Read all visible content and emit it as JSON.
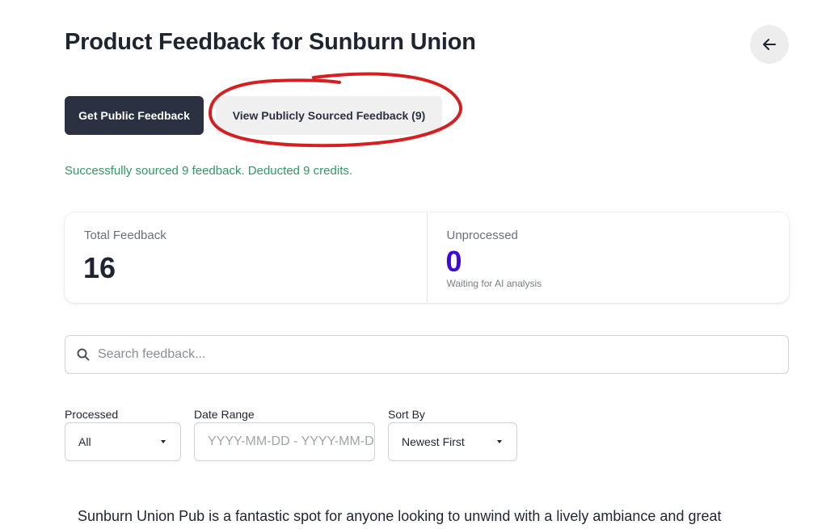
{
  "header": {
    "title": "Product Feedback for Sunburn Union",
    "back_icon": "arrow-left-icon"
  },
  "actions": {
    "get_public_feedback": "Get Public Feedback",
    "view_sourced_feedback": "View Publicly Sourced Feedback (9)"
  },
  "annotation": {
    "color": "#d42020"
  },
  "status": {
    "success_message": "Successfully sourced 9 feedback. Deducted 9 credits."
  },
  "stats": {
    "total": {
      "label": "Total Feedback",
      "value": "16"
    },
    "unprocessed": {
      "label": "Unprocessed",
      "value": "0",
      "subtext": "Waiting for AI analysis",
      "color": "#3f0ad6"
    }
  },
  "search": {
    "placeholder": "Search feedback...",
    "icon": "search-icon"
  },
  "filters": {
    "processed": {
      "label": "Processed",
      "value": "All"
    },
    "date_range": {
      "label": "Date Range",
      "placeholder": "YYYY-MM-DD - YYYY-MM-DD"
    },
    "sort_by": {
      "label": "Sort By",
      "value": "Newest First"
    }
  },
  "feedback_list": [
    {
      "text": "Sunburn Union Pub is a fantastic spot for anyone looking to unwind with a lively ambiance and great"
    }
  ]
}
